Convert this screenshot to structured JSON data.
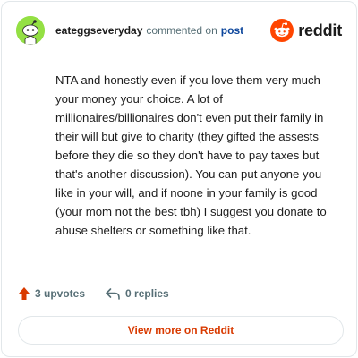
{
  "comment": {
    "username": "eateggseveryday",
    "action_text": "commented on",
    "post_link": "post",
    "body": "NTA and honestly even if you love them very much your money your choice. A lot of millionaires/billionaires don't even put their family in their will but give to charity (they gifted the assests before they die so they don't have to pay taxes but that's another discussion). You can put anyone you like in your will, and if noone in your family is good (your mom not the best tbh) I suggest you donate to abuse shelters or something like that.",
    "upvotes": "3 upvotes",
    "replies": "0 replies"
  },
  "brand": {
    "name": "reddit",
    "accent_color": "#ff4500"
  },
  "footer": {
    "view_more_label": "View more on Reddit"
  },
  "icons": {
    "avatar": "snoo-avatar-icon",
    "brand": "reddit-logo-icon",
    "upvote": "upvote-arrow-icon",
    "reply": "reply-arrow-icon"
  },
  "colors": {
    "avatar_bg": "#94e044",
    "upvote": "#d93a00",
    "link": "#0a449b",
    "muted": "#576f76"
  }
}
